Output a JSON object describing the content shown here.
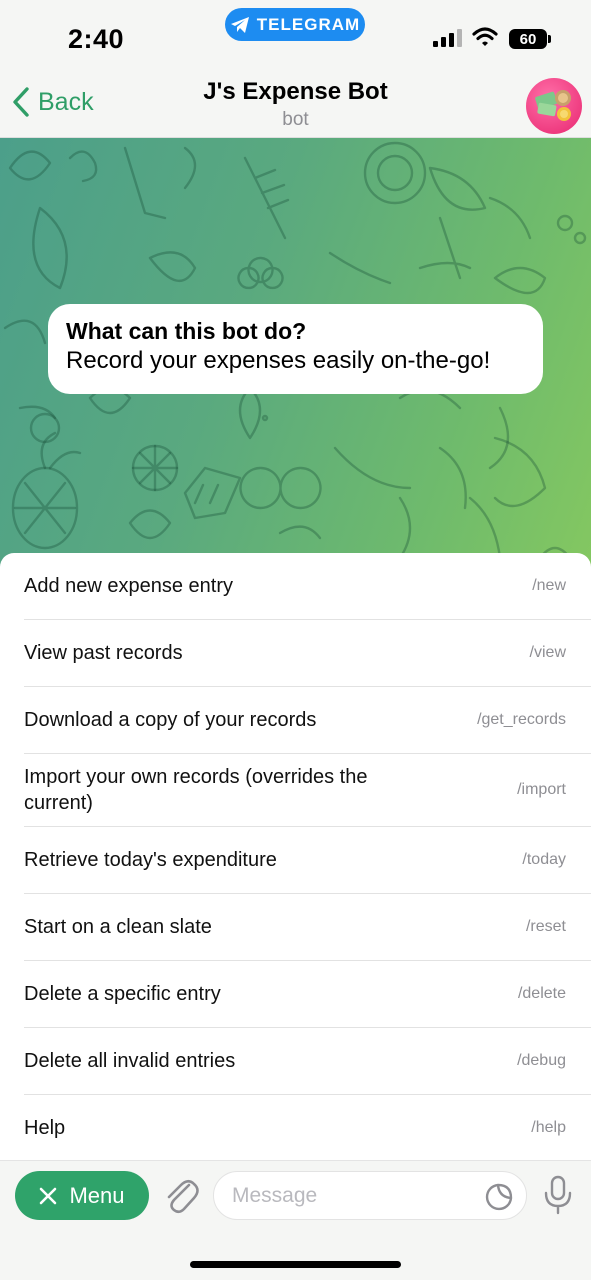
{
  "status_bar": {
    "time": "2:40",
    "app_pill": "TELEGRAM",
    "battery": "60"
  },
  "header": {
    "back_label": "Back",
    "title": "J's Expense Bot",
    "subtitle": "bot"
  },
  "bot_info": {
    "heading": "What can this bot do?",
    "description": "Record your expenses easily on-the-go!"
  },
  "commands": [
    {
      "description": "Add new expense entry",
      "command": "/new"
    },
    {
      "description": "View past records",
      "command": "/view"
    },
    {
      "description": "Download a copy of your records",
      "command": "/get_records"
    },
    {
      "description": "Import your own records (overrides the current)",
      "command": "/import"
    },
    {
      "description": "Retrieve today's expenditure",
      "command": "/today"
    },
    {
      "description": "Start on a clean slate",
      "command": "/reset"
    },
    {
      "description": "Delete a specific entry",
      "command": "/delete"
    },
    {
      "description": "Delete all invalid entries",
      "command": "/debug"
    },
    {
      "description": "Help",
      "command": "/help"
    }
  ],
  "input_bar": {
    "menu_label": "Menu",
    "message_placeholder": "Message"
  },
  "colors": {
    "accent": "#2fa36a",
    "telegram_blue": "#1d8cf1"
  }
}
